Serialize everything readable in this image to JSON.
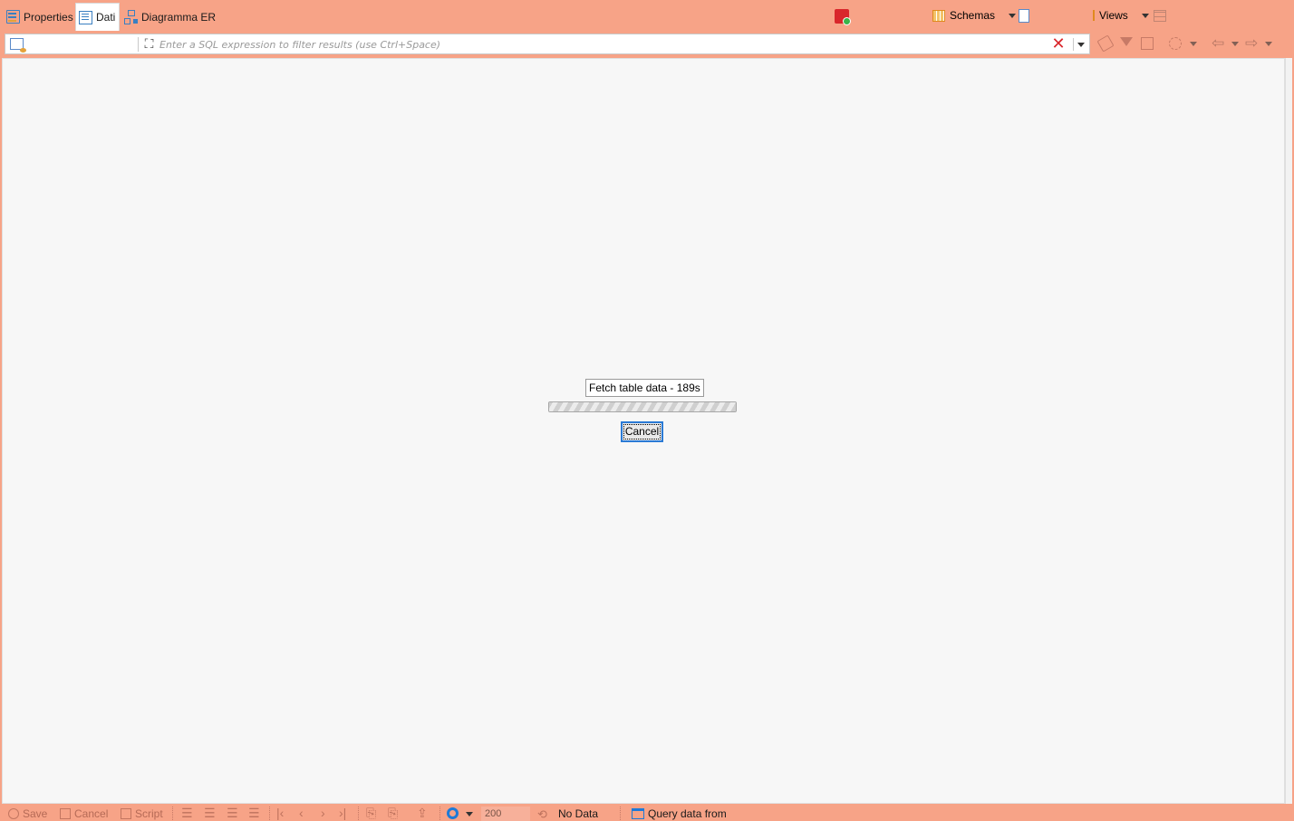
{
  "tabs": [
    {
      "label": "Properties",
      "icon": "properties-icon",
      "active": false
    },
    {
      "label": "Dati",
      "icon": "data-grid-icon",
      "active": true
    },
    {
      "label": "Diagramma ER",
      "icon": "er-diagram-icon",
      "active": false
    }
  ],
  "header": {
    "schemas_label": "Schemas",
    "views_label": "Views"
  },
  "filter": {
    "placeholder": "Enter a SQL expression to filter results (use Ctrl+Space)",
    "value": ""
  },
  "progress": {
    "label": "Fetch table data - 189s",
    "cancel_label": "Cancel"
  },
  "bottom": {
    "save_label": "Save",
    "cancel_label": "Cancel",
    "script_label": "Script",
    "fetch_size": "200",
    "status": "No Data",
    "query_label": "Query data from"
  },
  "colors": {
    "chrome": "#f7a387",
    "content_bg": "#f7f7f7",
    "focus_blue": "#2a7ad5",
    "error_red": "#d9262b"
  }
}
